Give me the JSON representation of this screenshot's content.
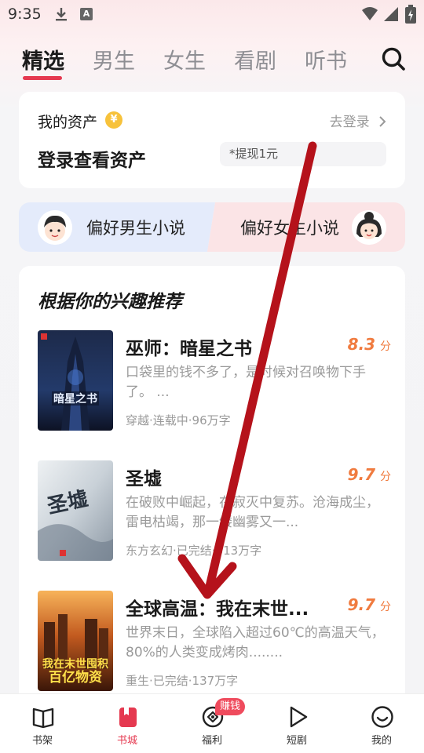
{
  "status_bar": {
    "time": "9:35",
    "a_label": "A"
  },
  "tabs": [
    {
      "label": "精选",
      "active": true
    },
    {
      "label": "男生",
      "active": false
    },
    {
      "label": "女生",
      "active": false
    },
    {
      "label": "看剧",
      "active": false
    },
    {
      "label": "听书",
      "active": false
    }
  ],
  "asset": {
    "title": "我的资产",
    "coin_symbol": "¥",
    "login_link": "去登录",
    "main_text": "登录查看资产",
    "withdraw_pill": "*提现1元"
  },
  "preferences": {
    "male": "偏好男生小说",
    "female": "偏好女生小说"
  },
  "recommend": {
    "title": "根据你的兴趣推荐",
    "books": [
      {
        "title": "巫师：暗星之书",
        "score": "8.3",
        "score_unit": "分",
        "desc": "口袋里的钱不多了，是时候对召唤物下手了。 ...",
        "meta": "穿越·连载中·96万字"
      },
      {
        "title": "圣墟",
        "score": "9.7",
        "score_unit": "分",
        "desc": "在破败中崛起，在寂灭中复苏。沧海成尘，雷电枯竭，那一缕幽雾又一...",
        "meta": "东方玄幻·已完结·613万字"
      },
      {
        "title": "全球高温：我在末世...",
        "score": "9.7",
        "score_unit": "分",
        "desc": "世界末日，全球陷入超过60℃的高温天气，80%的人类变成烤肉........",
        "meta": "重生·已完结·137万字"
      }
    ]
  },
  "bottom_nav": [
    {
      "label": "书架",
      "icon": "bookshelf-icon",
      "active": false
    },
    {
      "label": "书城",
      "icon": "bookstore-icon",
      "active": true
    },
    {
      "label": "福利",
      "icon": "welfare-icon",
      "active": false
    },
    {
      "label": "短剧",
      "icon": "play-icon",
      "active": false
    },
    {
      "label": "我的",
      "icon": "profile-icon",
      "active": false
    }
  ],
  "earn_badge": "赚钱",
  "colors": {
    "accent": "#e53950",
    "score": "#f07b3f",
    "arrow": "#b5121b"
  }
}
